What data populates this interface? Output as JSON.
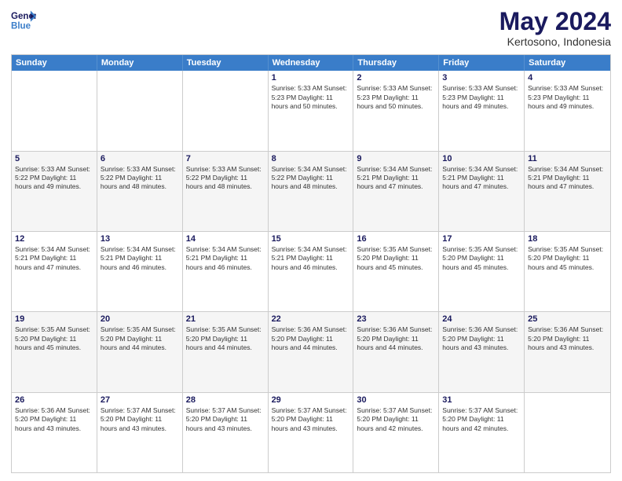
{
  "logo": {
    "line1": "General",
    "line2": "Blue"
  },
  "title": "May 2024",
  "subtitle": "Kertosono, Indonesia",
  "header_days": [
    "Sunday",
    "Monday",
    "Tuesday",
    "Wednesday",
    "Thursday",
    "Friday",
    "Saturday"
  ],
  "weeks": [
    [
      {
        "day": "",
        "info": ""
      },
      {
        "day": "",
        "info": ""
      },
      {
        "day": "",
        "info": ""
      },
      {
        "day": "1",
        "info": "Sunrise: 5:33 AM\nSunset: 5:23 PM\nDaylight: 11 hours\nand 50 minutes."
      },
      {
        "day": "2",
        "info": "Sunrise: 5:33 AM\nSunset: 5:23 PM\nDaylight: 11 hours\nand 50 minutes."
      },
      {
        "day": "3",
        "info": "Sunrise: 5:33 AM\nSunset: 5:23 PM\nDaylight: 11 hours\nand 49 minutes."
      },
      {
        "day": "4",
        "info": "Sunrise: 5:33 AM\nSunset: 5:23 PM\nDaylight: 11 hours\nand 49 minutes."
      }
    ],
    [
      {
        "day": "5",
        "info": "Sunrise: 5:33 AM\nSunset: 5:22 PM\nDaylight: 11 hours\nand 49 minutes."
      },
      {
        "day": "6",
        "info": "Sunrise: 5:33 AM\nSunset: 5:22 PM\nDaylight: 11 hours\nand 48 minutes."
      },
      {
        "day": "7",
        "info": "Sunrise: 5:33 AM\nSunset: 5:22 PM\nDaylight: 11 hours\nand 48 minutes."
      },
      {
        "day": "8",
        "info": "Sunrise: 5:34 AM\nSunset: 5:22 PM\nDaylight: 11 hours\nand 48 minutes."
      },
      {
        "day": "9",
        "info": "Sunrise: 5:34 AM\nSunset: 5:21 PM\nDaylight: 11 hours\nand 47 minutes."
      },
      {
        "day": "10",
        "info": "Sunrise: 5:34 AM\nSunset: 5:21 PM\nDaylight: 11 hours\nand 47 minutes."
      },
      {
        "day": "11",
        "info": "Sunrise: 5:34 AM\nSunset: 5:21 PM\nDaylight: 11 hours\nand 47 minutes."
      }
    ],
    [
      {
        "day": "12",
        "info": "Sunrise: 5:34 AM\nSunset: 5:21 PM\nDaylight: 11 hours\nand 47 minutes."
      },
      {
        "day": "13",
        "info": "Sunrise: 5:34 AM\nSunset: 5:21 PM\nDaylight: 11 hours\nand 46 minutes."
      },
      {
        "day": "14",
        "info": "Sunrise: 5:34 AM\nSunset: 5:21 PM\nDaylight: 11 hours\nand 46 minutes."
      },
      {
        "day": "15",
        "info": "Sunrise: 5:34 AM\nSunset: 5:21 PM\nDaylight: 11 hours\nand 46 minutes."
      },
      {
        "day": "16",
        "info": "Sunrise: 5:35 AM\nSunset: 5:20 PM\nDaylight: 11 hours\nand 45 minutes."
      },
      {
        "day": "17",
        "info": "Sunrise: 5:35 AM\nSunset: 5:20 PM\nDaylight: 11 hours\nand 45 minutes."
      },
      {
        "day": "18",
        "info": "Sunrise: 5:35 AM\nSunset: 5:20 PM\nDaylight: 11 hours\nand 45 minutes."
      }
    ],
    [
      {
        "day": "19",
        "info": "Sunrise: 5:35 AM\nSunset: 5:20 PM\nDaylight: 11 hours\nand 45 minutes."
      },
      {
        "day": "20",
        "info": "Sunrise: 5:35 AM\nSunset: 5:20 PM\nDaylight: 11 hours\nand 44 minutes."
      },
      {
        "day": "21",
        "info": "Sunrise: 5:35 AM\nSunset: 5:20 PM\nDaylight: 11 hours\nand 44 minutes."
      },
      {
        "day": "22",
        "info": "Sunrise: 5:36 AM\nSunset: 5:20 PM\nDaylight: 11 hours\nand 44 minutes."
      },
      {
        "day": "23",
        "info": "Sunrise: 5:36 AM\nSunset: 5:20 PM\nDaylight: 11 hours\nand 44 minutes."
      },
      {
        "day": "24",
        "info": "Sunrise: 5:36 AM\nSunset: 5:20 PM\nDaylight: 11 hours\nand 43 minutes."
      },
      {
        "day": "25",
        "info": "Sunrise: 5:36 AM\nSunset: 5:20 PM\nDaylight: 11 hours\nand 43 minutes."
      }
    ],
    [
      {
        "day": "26",
        "info": "Sunrise: 5:36 AM\nSunset: 5:20 PM\nDaylight: 11 hours\nand 43 minutes."
      },
      {
        "day": "27",
        "info": "Sunrise: 5:37 AM\nSunset: 5:20 PM\nDaylight: 11 hours\nand 43 minutes."
      },
      {
        "day": "28",
        "info": "Sunrise: 5:37 AM\nSunset: 5:20 PM\nDaylight: 11 hours\nand 43 minutes."
      },
      {
        "day": "29",
        "info": "Sunrise: 5:37 AM\nSunset: 5:20 PM\nDaylight: 11 hours\nand 43 minutes."
      },
      {
        "day": "30",
        "info": "Sunrise: 5:37 AM\nSunset: 5:20 PM\nDaylight: 11 hours\nand 42 minutes."
      },
      {
        "day": "31",
        "info": "Sunrise: 5:37 AM\nSunset: 5:20 PM\nDaylight: 11 hours\nand 42 minutes."
      },
      {
        "day": "",
        "info": ""
      }
    ]
  ]
}
